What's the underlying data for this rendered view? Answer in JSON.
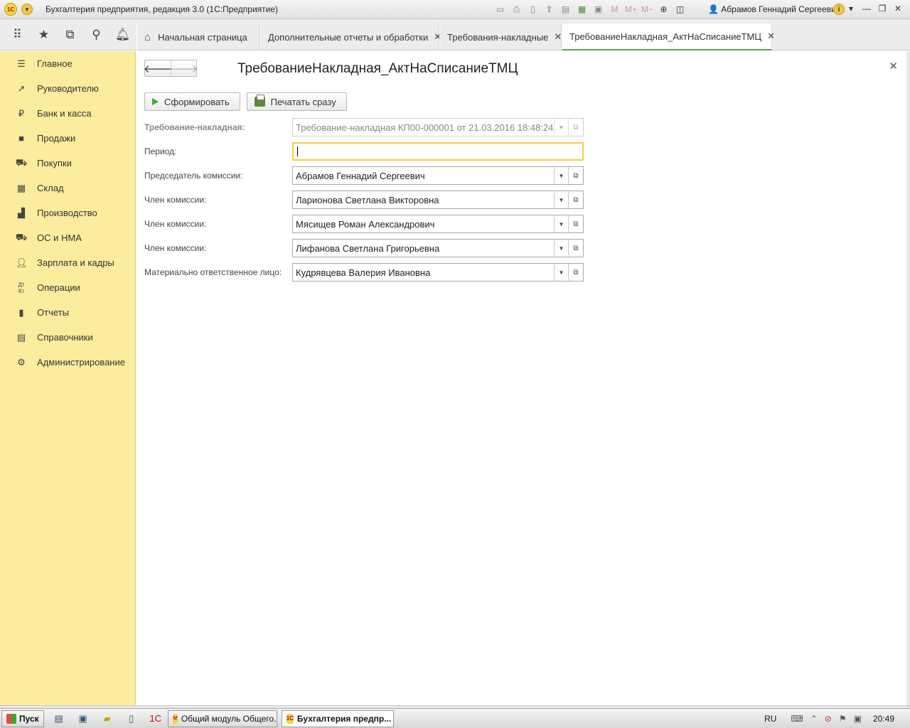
{
  "window": {
    "title": "Бухгалтерия предприятия, редакция 3.0  (1С:Предприятие)",
    "logo": "1С",
    "user": "Абрамов Геннадий Сергеевич"
  },
  "tabs": [
    {
      "label": "Начальная страница",
      "closable": false
    },
    {
      "label": "Дополнительные отчеты и обработки",
      "closable": true
    },
    {
      "label": "Требования-накладные",
      "closable": true
    },
    {
      "label": "ТребованиеНакладная_АктНаСписаниеТМЦ",
      "closable": true
    }
  ],
  "sidebar": {
    "items": [
      {
        "label": "Главное",
        "icon": "menu-icon"
      },
      {
        "label": "Руководителю",
        "icon": "trend-icon"
      },
      {
        "label": "Банк и касса",
        "icon": "ruble-icon"
      },
      {
        "label": "Продажи",
        "icon": "bag-icon"
      },
      {
        "label": "Покупки",
        "icon": "cart-icon"
      },
      {
        "label": "Склад",
        "icon": "warehouse-icon"
      },
      {
        "label": "Производство",
        "icon": "factory-icon"
      },
      {
        "label": "ОС и НМА",
        "icon": "truck-icon"
      },
      {
        "label": "Зарплата и кадры",
        "icon": "person-icon"
      },
      {
        "label": "Операции",
        "icon": "dt-kt-icon"
      },
      {
        "label": "Отчеты",
        "icon": "bar-chart-icon"
      },
      {
        "label": "Справочники",
        "icon": "books-icon"
      },
      {
        "label": "Администрирование",
        "icon": "gear-icon"
      }
    ]
  },
  "form": {
    "title": "ТребованиеНакладная_АктНаСписаниеТМЦ",
    "buttons": {
      "generate": "Сформировать",
      "print": "Печатать сразу"
    },
    "fields": {
      "document": {
        "label": "Требование-накладная:",
        "value": "Требование-накладная КП00-000001 от 21.03.2016 18:48:24"
      },
      "period": {
        "label": "Период:",
        "value": ""
      },
      "chairman": {
        "label": "Председатель комиссии:",
        "value": "Абрамов Геннадий Сергеевич"
      },
      "member1": {
        "label": "Член комиссии:",
        "value": "Ларионова Светлана Викторовна"
      },
      "member2": {
        "label": "Член комиссии:",
        "value": "Мясищев Роман Александрович"
      },
      "member3": {
        "label": "Член комиссии:",
        "value": "Лифанова Светлана Григорьевна"
      },
      "responsible": {
        "label": "Материально ответственное лицо:",
        "value": "Кудрявцева Валерия Ивановна"
      }
    }
  },
  "taskbar": {
    "start": "Пуск",
    "tasks": [
      {
        "label": "Общий модуль Общего..."
      },
      {
        "label": "Бухгалтерия предпр..."
      }
    ],
    "lang": "RU",
    "clock": "20:49"
  }
}
